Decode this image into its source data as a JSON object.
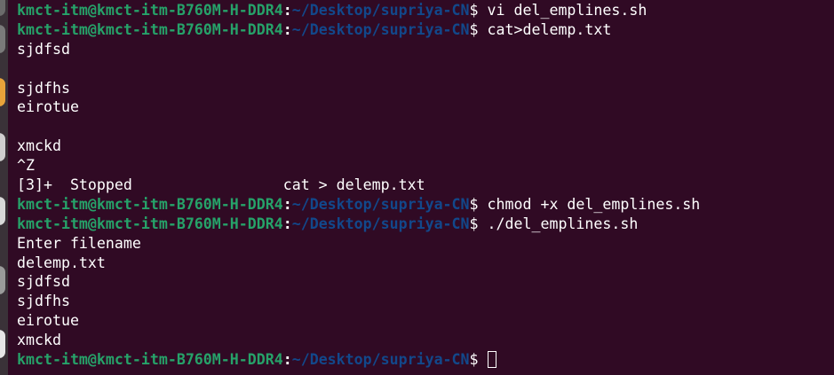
{
  "prompt": {
    "user_host": "kmct-itm@kmct-itm-B760M-H-DDR4",
    "path": "~/Desktop/supriya-CN"
  },
  "lines": [
    {
      "type": "prompt",
      "cmd": " vi del_emplines.sh"
    },
    {
      "type": "prompt",
      "cmd": " cat>delemp.txt"
    },
    {
      "type": "output",
      "text": "sjdfsd"
    },
    {
      "type": "output",
      "text": ""
    },
    {
      "type": "output",
      "text": "sjdfhs"
    },
    {
      "type": "output",
      "text": "eirotue"
    },
    {
      "type": "output",
      "text": ""
    },
    {
      "type": "output",
      "text": "xmckd"
    },
    {
      "type": "output",
      "text": "^Z"
    },
    {
      "type": "output",
      "text": "[3]+  Stopped                 cat > delemp.txt"
    },
    {
      "type": "prompt",
      "cmd": " chmod +x del_emplines.sh"
    },
    {
      "type": "prompt",
      "cmd": " ./del_emplines.sh"
    },
    {
      "type": "output",
      "text": "Enter filename"
    },
    {
      "type": "output",
      "text": "delemp.txt"
    },
    {
      "type": "output",
      "text": "sjdfsd"
    },
    {
      "type": "output",
      "text": "sjdfhs"
    },
    {
      "type": "output",
      "text": "eirotue"
    },
    {
      "type": "output",
      "text": "xmckd"
    },
    {
      "type": "prompt",
      "cmd": " ",
      "cursor": true
    }
  ],
  "colors": {
    "background": "#300a24",
    "user_host": "#26a269",
    "path": "#12488b",
    "text": "#ffffff"
  }
}
